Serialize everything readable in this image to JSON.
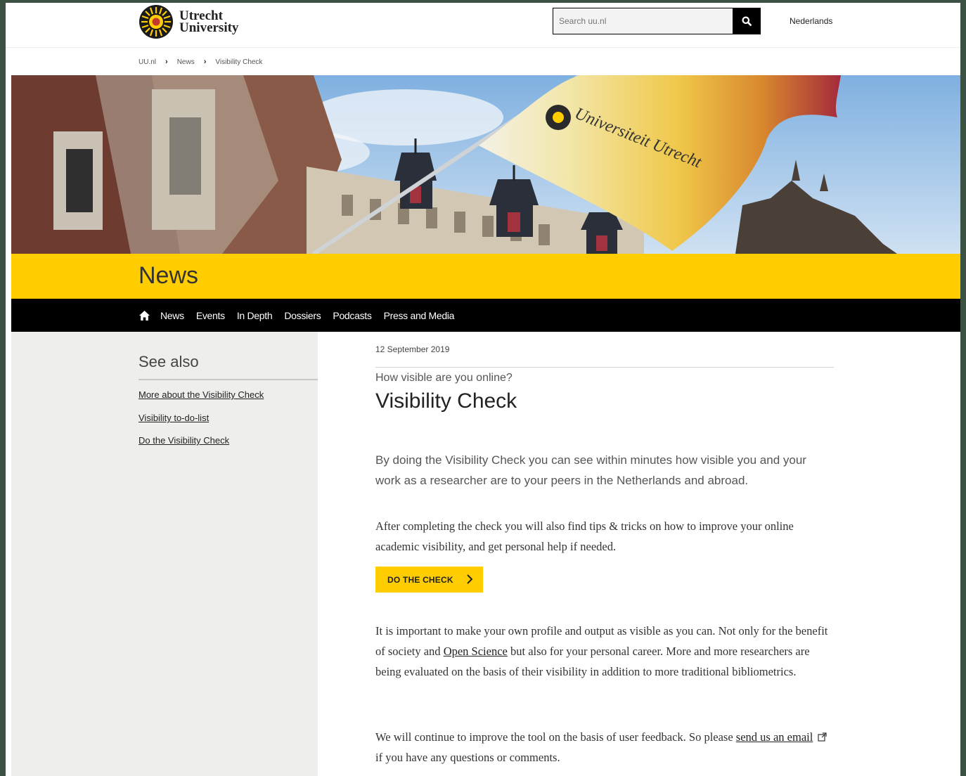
{
  "header": {
    "logo_line1": "Utrecht",
    "logo_line2": "University",
    "search_placeholder": "Search uu.nl",
    "language_link": "Nederlands"
  },
  "breadcrumb": [
    "UU.nl",
    "News",
    "Visibility Check"
  ],
  "hero": {
    "flag_text": "Universiteit Utrecht"
  },
  "section_title": "News",
  "nav": {
    "items": [
      "News",
      "Events",
      "In Depth",
      "Dossiers",
      "Podcasts",
      "Press and Media"
    ]
  },
  "sidebar": {
    "heading": "See also",
    "links": [
      "More about the Visibility Check",
      "Visibility to-do-list",
      "Do the Visibility Check"
    ]
  },
  "article": {
    "date": "12 September 2019",
    "kicker": "How visible are you online?",
    "title": "Visibility Check",
    "intro": "By doing the Visibility Check you can see within minutes how visible you and your work as a researcher are to your peers in the Netherlands and abroad.",
    "para1": "After completing the check you will also find tips & tricks on how to improve your online academic visibility, and get personal help if needed.",
    "cta_label": "DO THE CHECK",
    "para2_before": "It is important to make your own profile and output as visible as you can. Not only for the benefit of society and ",
    "para2_link": "Open Science",
    "para2_after": " but also for your personal career. More and more researchers are being evaluated on the basis of their visibility in addition to more traditional bibliometrics.",
    "para3_before": "We will continue to improve the tool on the basis of user feedback. So please ",
    "para3_link": "send us an email",
    "para3_after": " if you have any questions or comments."
  },
  "colors": {
    "brand_yellow": "#ffcd00",
    "nav_black": "#000000",
    "sidebar_gray": "#eeeeec"
  }
}
